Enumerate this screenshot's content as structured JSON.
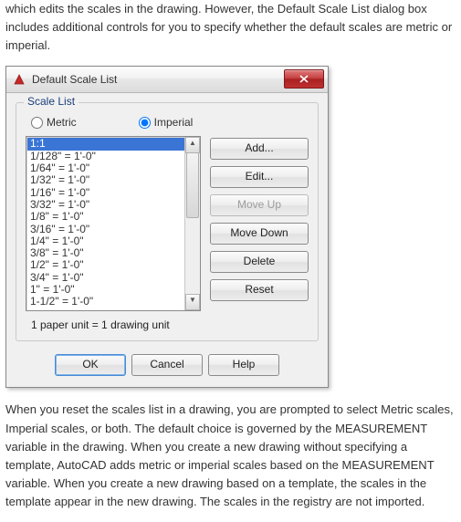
{
  "doc": {
    "para_top": "which edits the scales in the drawing. However, the Default Scale List dialog box includes additional controls for you to specify whether the default scales are metric or imperial.",
    "para_bottom": "When you reset the scales list in a drawing, you are prompted to select Metric scales, Imperial scales, or both. The default choice is governed by the MEASUREMENT variable in the drawing. When you create a new drawing without specifying a template, AutoCAD adds metric or imperial scales based on the MEASUREMENT variable. When you create a new drawing based on a template, the scales in the template appear in the new drawing. The scales in the registry are not imported."
  },
  "dialog": {
    "title": "Default Scale List",
    "group_label": "Scale List",
    "radio_metric": "Metric",
    "radio_imperial": "Imperial",
    "selected_radio": "Imperial",
    "scales": [
      "1:1",
      "1/128\" = 1'-0\"",
      "1/64\" = 1'-0\"",
      "1/32\" = 1'-0\"",
      "1/16\" = 1'-0\"",
      "3/32\" = 1'-0\"",
      "1/8\" = 1'-0\"",
      "3/16\" = 1'-0\"",
      "1/4\" = 1'-0\"",
      "3/8\" = 1'-0\"",
      "1/2\" = 1'-0\"",
      "3/4\" = 1'-0\"",
      "1\" = 1'-0\"",
      "1-1/2\" = 1'-0\""
    ],
    "selected_scale_index": 0,
    "buttons": {
      "add": "Add...",
      "edit": "Edit...",
      "move_up": "Move Up",
      "move_down": "Move Down",
      "delete": "Delete",
      "reset": "Reset"
    },
    "footer_note": "1 paper unit = 1 drawing unit",
    "ok": "OK",
    "cancel": "Cancel",
    "help": "Help"
  }
}
